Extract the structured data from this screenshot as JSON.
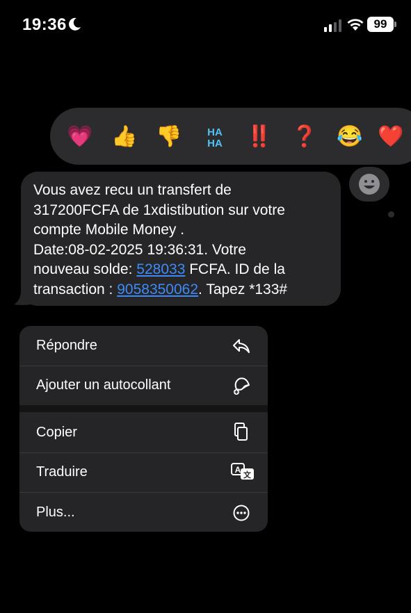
{
  "status_bar": {
    "time": "19:36",
    "battery": "99"
  },
  "reactions": [
    "💗",
    "👍",
    "👎",
    "🆗",
    "‼️",
    "❓",
    "😂",
    "❤️"
  ],
  "message": {
    "line1": "Vous avez recu un transfert de",
    "line2": "317200FCFA de 1xdistibution sur votre",
    "line3": "compte Mobile Money .",
    "line4": "Date:08-02-2025 19:36:31. Votre",
    "line5_pre": "nouveau solde: ",
    "balance_link": "528033",
    "line5_post": " FCFA. ID de la",
    "line6_pre": "transaction : ",
    "transaction_link": "9058350062",
    "line6_post": ". Tapez *133#"
  },
  "menu": {
    "reply": "Répondre",
    "sticker": "Ajouter un autocollant",
    "copy": "Copier",
    "translate": "Traduire",
    "more": "Plus..."
  }
}
